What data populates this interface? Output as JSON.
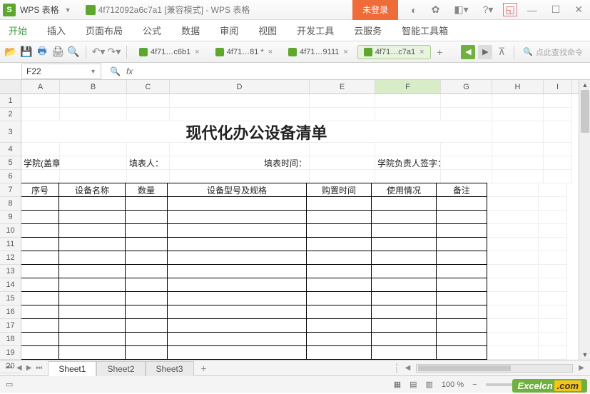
{
  "app": {
    "name": "WPS 表格",
    "doc_title": "4f712092a6c7a1 [兼容模式] - WPS 表格",
    "login": "未登录"
  },
  "menu": {
    "start": "开始",
    "insert": "插入",
    "layout": "页面布局",
    "formula": "公式",
    "data": "数据",
    "review": "审阅",
    "view": "视图",
    "dev": "开发工具",
    "cloud": "云服务",
    "smart": "智能工具箱"
  },
  "tabs": {
    "t1": "4f71…c6b1",
    "t2": "4f71…81 *",
    "t3": "4f71…9111",
    "t4": "4f71…c7a1",
    "close": "×"
  },
  "search": {
    "placeholder": "点此查找命令"
  },
  "formula": {
    "cell_ref": "F22",
    "fx": "fx"
  },
  "columns": {
    "A": "A",
    "B": "B",
    "C": "C",
    "D": "D",
    "E": "E",
    "F": "F",
    "G": "G",
    "H": "H",
    "I": "I"
  },
  "rows": [
    "1",
    "2",
    "3",
    "4",
    "5",
    "6",
    "7",
    "8",
    "9",
    "10",
    "11",
    "12",
    "13",
    "14",
    "15",
    "16",
    "17",
    "18",
    "19",
    "20"
  ],
  "sheet": {
    "title": "现代化办公设备清单",
    "info": {
      "college": "学院(盖章)：",
      "filler": "填表人：",
      "fill_time": "填表时间：",
      "leader": "学院负责人签字："
    },
    "headers": {
      "no": "序号",
      "name": "设备名称",
      "qty": "数量",
      "model": "设备型号及规格",
      "buy": "购置时间",
      "use": "使用情况",
      "note": "备注"
    }
  },
  "sheets": {
    "s1": "Sheet1",
    "s2": "Sheet2",
    "s3": "Sheet3"
  },
  "status": {
    "zoom": "100 %"
  },
  "watermark": {
    "text": "Excelcn",
    "suffix": ".com"
  }
}
